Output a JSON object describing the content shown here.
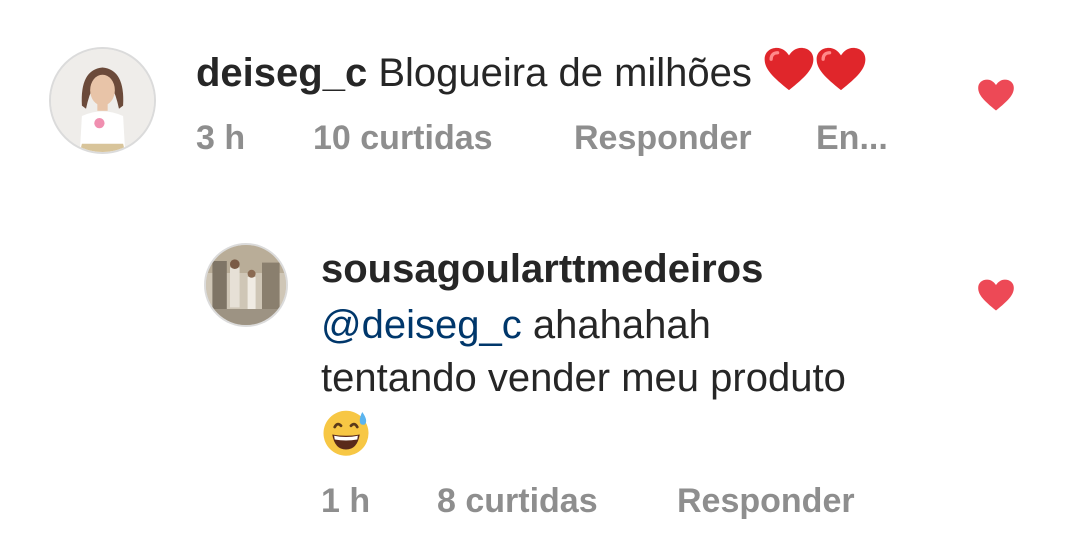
{
  "comments": [
    {
      "username": "deiseg_c",
      "text": "Blogueira de milhões",
      "emoji": [
        "red-heart",
        "red-heart"
      ],
      "time": "3 h",
      "likes": "10 curtidas",
      "reply_label": "Responder",
      "extra_label": "En...",
      "liked": true
    }
  ],
  "replies": [
    {
      "username": "sousagoularttmedeiros",
      "mention": "@deiseg_c",
      "text_line1": "ahahahah",
      "text_line2": "tentando vender meu produto",
      "emoji": "grinning-face-with-sweat",
      "time": "1 h",
      "likes": "8 curtidas",
      "reply_label": "Responder",
      "liked": true
    }
  ],
  "colors": {
    "text": "#262626",
    "meta": "#8e8e8e",
    "mention": "#00376b",
    "heart": "#ed4956"
  }
}
